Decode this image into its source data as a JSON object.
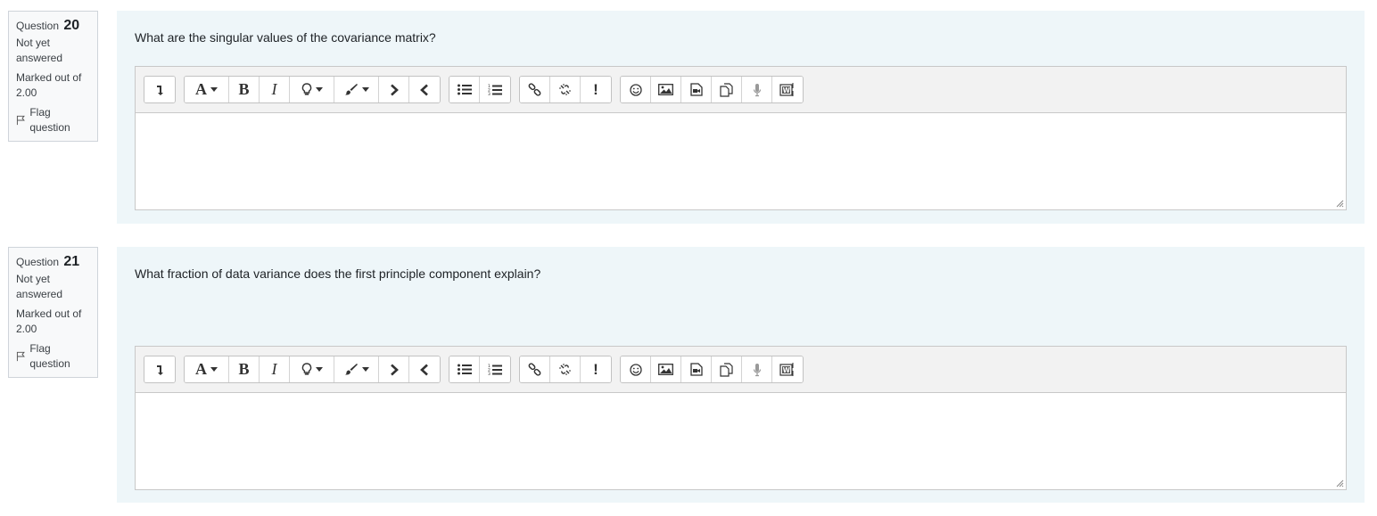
{
  "questions": [
    {
      "label": "Question",
      "number": "20",
      "state": "Not yet answered",
      "grade": "Marked out of 2.00",
      "flag_label": "Flag question",
      "text": "What are the singular values of the covariance matrix?",
      "answer": ""
    },
    {
      "label": "Question",
      "number": "21",
      "state": "Not yet answered",
      "grade": "Marked out of 2.00",
      "flag_label": "Flag question",
      "text": "What fraction of data variance does the first principle component explain?",
      "answer": ""
    }
  ],
  "toolbar": {
    "font_letter": "A",
    "bold_letter": "B",
    "italic_letter": "I",
    "alert_glyph": "!",
    "buttons": [
      "toolbar-toggle-icon",
      "font-size-icon",
      "bold-icon",
      "italic-icon",
      "lightbulb-icon",
      "brush-icon",
      "indent-icon",
      "outdent-icon",
      "bullet-list-icon",
      "numbered-list-icon",
      "link-icon",
      "unlink-icon",
      "exclamation-icon",
      "emoji-icon",
      "image-icon",
      "media-icon",
      "manage-files-icon",
      "record-audio-icon",
      "paste-word-icon"
    ]
  },
  "colors": {
    "content_bg": "#eef6f9",
    "info_bg": "#f8f9fa",
    "toolbar_bg": "#f2f2f2",
    "border": "#c8c8c8"
  }
}
